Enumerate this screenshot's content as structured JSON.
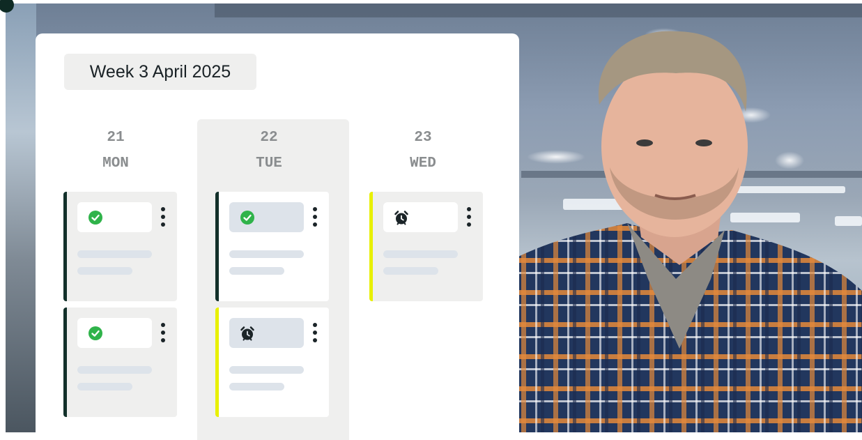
{
  "planner": {
    "week_label": "Week 3 April 2025",
    "days": [
      {
        "number": "21",
        "name": "MON"
      },
      {
        "number": "22",
        "name": "TUE"
      },
      {
        "number": "23",
        "name": "WED"
      }
    ],
    "tasks": [
      {
        "day": "MON",
        "status": "done",
        "icon": "check-circle-icon"
      },
      {
        "day": "MON",
        "status": "done",
        "icon": "check-circle-icon"
      },
      {
        "day": "TUE",
        "status": "done",
        "icon": "check-circle-icon"
      },
      {
        "day": "TUE",
        "status": "pending",
        "icon": "alarm-clock-icon"
      },
      {
        "day": "WED",
        "status": "pending",
        "icon": "alarm-clock-icon"
      }
    ]
  },
  "colors": {
    "done_accent": "#12302a",
    "pending_accent": "#e8f000",
    "check_green": "#2fb34a",
    "selected_column": "#efefee"
  }
}
